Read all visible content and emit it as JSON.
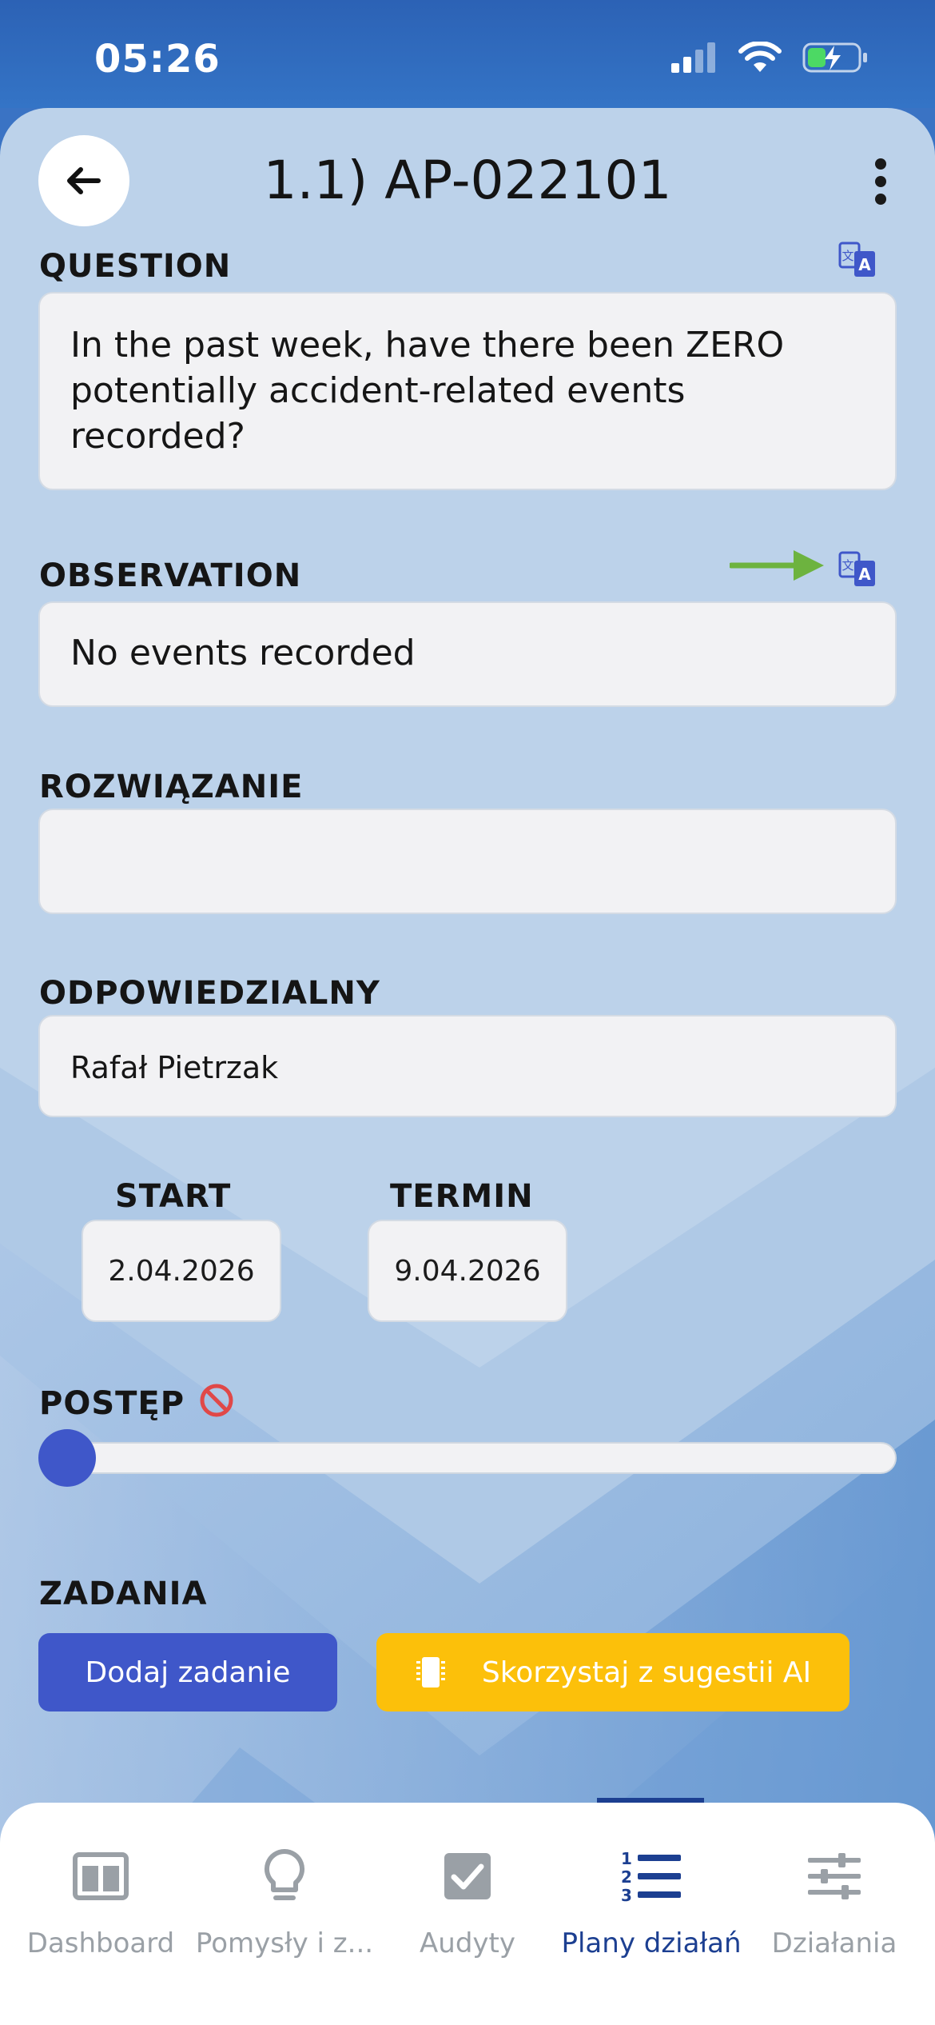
{
  "status_bar": {
    "time": "05:26"
  },
  "header": {
    "title": "1.1) AP-022101"
  },
  "question": {
    "label": "QUESTION",
    "text_lines": [
      "In the past week, have there been ZERO",
      "potentially accident-related events",
      "recorded?"
    ]
  },
  "observation": {
    "label": "OBSERVATION",
    "text": "No events recorded"
  },
  "solution": {
    "label": "ROZWIĄZANIE",
    "value": ""
  },
  "responsible": {
    "label": "ODPOWIEDZIALNY",
    "value": "Rafał Pietrzak"
  },
  "dates": {
    "start_label": "START",
    "start_value": "2.04.2026",
    "due_label": "TERMIN",
    "due_value": "9.04.2026"
  },
  "progress": {
    "label": "POSTĘP",
    "value_percent": 0
  },
  "tasks": {
    "label": "ZADANIA",
    "add_button": "Dodaj zadanie",
    "ai_button": "Skorzystaj z sugestii AI"
  },
  "tab_bar": {
    "active_index": 3,
    "items": [
      {
        "label": "Dashboard",
        "icon": "dashboard-icon"
      },
      {
        "label": "Pomysły i z...",
        "icon": "lightbulb-icon"
      },
      {
        "label": "Audyty",
        "icon": "checkbox-icon"
      },
      {
        "label": "Plany działań",
        "icon": "numbered-list-icon"
      },
      {
        "label": "Działania",
        "icon": "sliders-icon"
      }
    ]
  },
  "colors": {
    "primary": "#3f57c9",
    "ai_button": "#fcc00a",
    "active_tab": "#1c3f91",
    "blocked_icon": "#e04848",
    "annotation_arrow": "#6db33f"
  }
}
